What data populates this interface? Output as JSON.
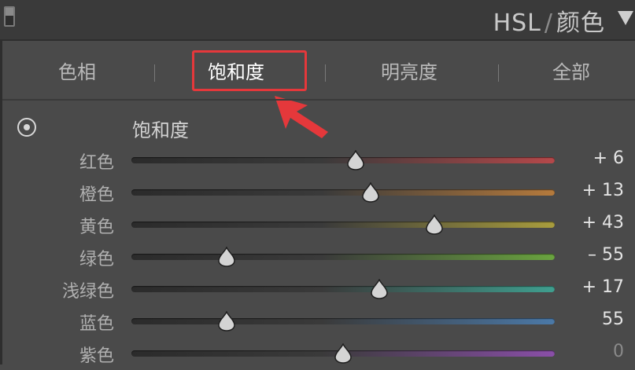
{
  "header": {
    "title_main": "HSL",
    "title_sep": "/",
    "title_alt": "颜色"
  },
  "tabs": [
    {
      "label": "色相",
      "active": false
    },
    {
      "label": "饱和度",
      "active": true
    },
    {
      "label": "明亮度",
      "active": false
    },
    {
      "label": "全部",
      "active": false
    }
  ],
  "section": {
    "title": "饱和度",
    "target_icon": "target-adjust-icon"
  },
  "sliders": [
    {
      "label": "红色",
      "value": 6,
      "display": "+ 6",
      "min": -100,
      "max": 100,
      "color": "#b5484a"
    },
    {
      "label": "橙色",
      "value": 13,
      "display": "+ 13",
      "min": -100,
      "max": 100,
      "color": "#b57a3c"
    },
    {
      "label": "黄色",
      "value": 43,
      "display": "+ 43",
      "min": -100,
      "max": 100,
      "color": "#a99d3d"
    },
    {
      "label": "绿色",
      "value": -55,
      "display": "– 55",
      "min": -100,
      "max": 100,
      "color": "#6aa43f"
    },
    {
      "label": "浅绿色",
      "value": 17,
      "display": "+ 17",
      "min": -100,
      "max": 100,
      "color": "#3f9f8f"
    },
    {
      "label": "蓝色",
      "value": -55,
      "display": "55",
      "min": -100,
      "max": 100,
      "color": "#4b79a8"
    },
    {
      "label": "紫色",
      "value": 0,
      "display": "0",
      "min": -100,
      "max": 100,
      "color": "#8a4fa8"
    }
  ],
  "annotation": {
    "color": "#e5383b"
  }
}
